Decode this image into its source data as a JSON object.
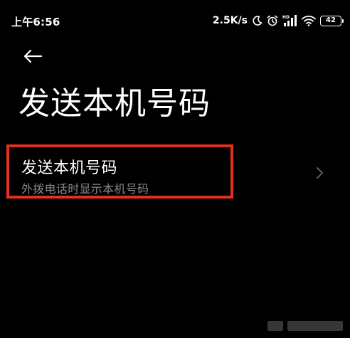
{
  "status_bar": {
    "time": "上午6:56",
    "net_speed": "2.5K/s",
    "battery": "42",
    "icons": [
      "moon-icon",
      "alarm-icon",
      "hd-signal-icon",
      "wifi-icon",
      "battery-icon"
    ]
  },
  "nav": {
    "back_icon": "arrow-left-icon"
  },
  "page": {
    "title": "发送本机号码"
  },
  "setting": {
    "title": "发送本机号码",
    "subtitle": "外拨电话时显示本机号码",
    "chevron_icon": "chevron-right-icon"
  },
  "colors": {
    "background": "#000000",
    "text_primary": "#ffffff",
    "text_secondary": "#8a8a8a",
    "highlight": "#e03222"
  }
}
